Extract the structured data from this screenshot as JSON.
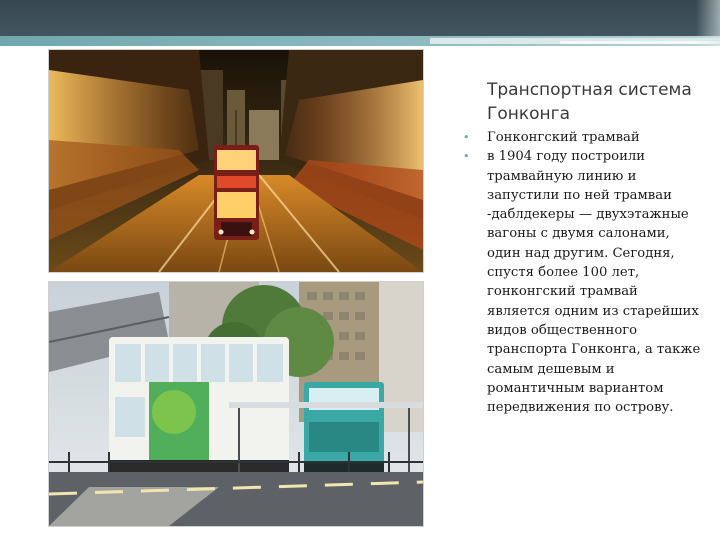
{
  "slide": {
    "title": "Транспортная система Гонконга",
    "bullets": [
      "Гонконгский трамвай",
      "в 1904 году построили трамвайную линию и запустили по ней трамваи -даблдекеры — двухэтажные вагоны с двумя салонами, один над другим. Сегодня, спустя более 100 лет, гонконгский трамвай является одним из старейших видов общественного транспорта Гонконга, а также самым дешевым и романтичным вариантом передвижения по острову."
    ],
    "bullet_glyph": "•"
  },
  "colors": {
    "top_band": "#455a64",
    "accent": "#6fa7ad",
    "text": "#1a1a1a"
  }
}
